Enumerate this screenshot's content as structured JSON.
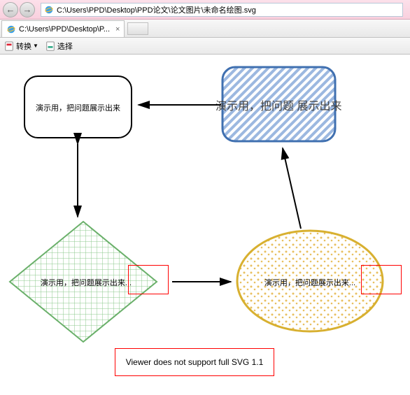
{
  "titlebar": {
    "url": "C:\\Users\\PPD\\Desktop\\PPD论文\\论文图片\\未命名绘图.svg"
  },
  "tab": {
    "title": "C:\\Users\\PPD\\Desktop\\P...",
    "close": "×"
  },
  "toolbar": {
    "convert": "转换",
    "select": "选择"
  },
  "shapes": {
    "rect_nw": "演示用，把问题展示出来",
    "blue_ne": "演示用，把问题 展示出来",
    "diamond_sw": "演示用，把问题展示出来...",
    "ellipse_se": "演示用，把问题展示出来..."
  },
  "error_msg": "Viewer does not support full SVG 1.1",
  "icons": {
    "back": "◄",
    "fwd": "►",
    "page": "▢",
    "drop": "▼"
  }
}
